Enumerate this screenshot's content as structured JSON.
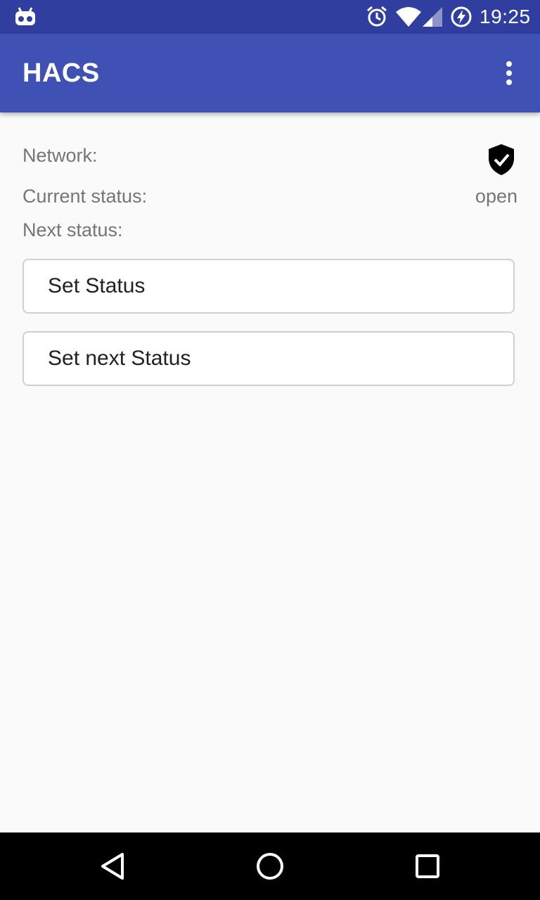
{
  "status_bar": {
    "time": "19:25",
    "icons": [
      "android-robot-icon",
      "alarm-clock-icon",
      "wifi-icon",
      "cell-signal-icon",
      "battery-charging-icon"
    ]
  },
  "app_bar": {
    "title": "HACS",
    "menu_icon": "more-vert-icon"
  },
  "main": {
    "network_label": "Network:",
    "network_icon": "shield-check-icon",
    "current_status_label": "Current status:",
    "current_status_value": "open",
    "next_status_label": "Next status:",
    "next_status_value": "",
    "set_status_button": "Set Status",
    "set_next_status_button": "Set next Status"
  },
  "nav_bar": {
    "icons": [
      "back-icon",
      "home-icon",
      "recents-icon"
    ]
  },
  "colors": {
    "primary": "#3f51b5",
    "primary_dark": "#303f9f",
    "background": "#fafafa"
  }
}
